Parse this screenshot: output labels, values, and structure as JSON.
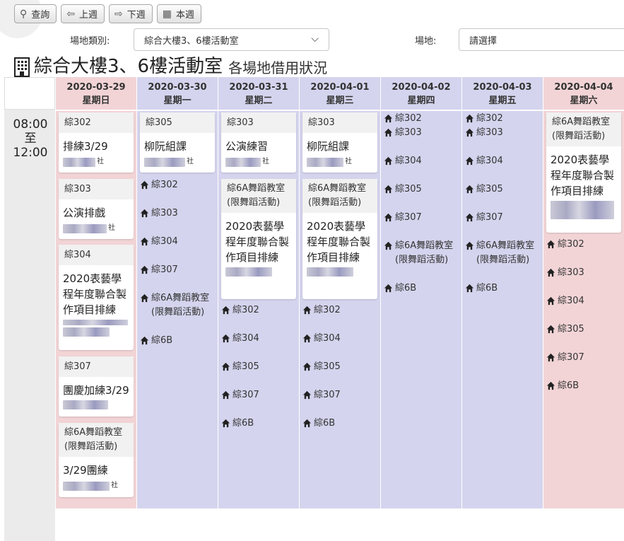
{
  "toolbar": {
    "query": "查詢",
    "prev": "上週",
    "next": "下週",
    "this_week": "本週"
  },
  "filters": {
    "category_label": "場地類別:",
    "category_value": "綜合大樓3、6樓活動室",
    "venue_label": "場地:",
    "venue_placeholder": "請選擇"
  },
  "title": {
    "main": "綜合大樓3、6樓活動室",
    "sub": "各場地借用狀況"
  },
  "time_slot": {
    "start": "08:00",
    "to": "至",
    "end": "12:00"
  },
  "days": [
    {
      "date": "2020-03-29",
      "weekday": "星期日"
    },
    {
      "date": "2020-03-30",
      "weekday": "星期一"
    },
    {
      "date": "2020-03-31",
      "weekday": "星期二"
    },
    {
      "date": "2020-04-01",
      "weekday": "星期三"
    },
    {
      "date": "2020-04-02",
      "weekday": "星期四"
    },
    {
      "date": "2020-04-03",
      "weekday": "星期五"
    },
    {
      "date": "2020-04-04",
      "weekday": "星期六"
    }
  ],
  "bookings": {
    "sun": [
      {
        "room": "綜302",
        "event": "排練3/29",
        "org": "社"
      },
      {
        "room": "綜303",
        "event": "公演排戲",
        "org": "社"
      },
      {
        "room": "綜304",
        "event": "2020表藝學程年度聯合製作項目排練",
        "org": ""
      },
      {
        "room": "綜307",
        "event": "團慶加練3/29",
        "org": ""
      },
      {
        "room": "綜6A舞蹈教室(限舞蹈活動)",
        "event": "3/29團練",
        "org": "社"
      }
    ],
    "mon": [
      {
        "room": "綜305",
        "event": "柳阮組課",
        "org": "社"
      }
    ],
    "tue": [
      {
        "room": "綜303",
        "event": "公演練習",
        "org": "社"
      },
      {
        "room": "綜6A舞蹈教室(限舞蹈活動)",
        "event": "2020表藝學程年度聯合製作項目排練",
        "org": ""
      }
    ],
    "wed": [
      {
        "room": "綜303",
        "event": "柳阮組課",
        "org": "社"
      },
      {
        "room": "綜6A舞蹈教室(限舞蹈活動)",
        "event": "2020表藝學程年度聯合製作項目排練",
        "org": ""
      }
    ],
    "sat": [
      {
        "room": "綜6A舞蹈教室(限舞蹈活動)",
        "event": "2020表藝學程年度聯合製作項目排練",
        "org": ""
      }
    ]
  },
  "free_rooms": {
    "mon": [
      "綜302",
      "綜303",
      "綜304",
      "綜307",
      "綜6A舞蹈教室(限舞蹈活動)",
      "綜6B"
    ],
    "tue": [
      "綜302",
      "綜304",
      "綜305",
      "綜307",
      "綜6B"
    ],
    "wed": [
      "綜302",
      "綜304",
      "綜305",
      "綜307",
      "綜6B"
    ],
    "thu": [
      "綜302",
      "綜303",
      "綜304",
      "綜305",
      "綜307",
      "綜6A舞蹈教室(限舞蹈活動)",
      "綜6B"
    ],
    "fri": [
      "綜302",
      "綜303",
      "綜304",
      "綜305",
      "綜307",
      "綜6A舞蹈教室(限舞蹈活動)",
      "綜6B"
    ],
    "sat": [
      "綜302",
      "綜303",
      "綜304",
      "綜305",
      "綜307",
      "綜6B"
    ]
  },
  "colors": {
    "weekday": "#d4d4ee",
    "weekend": "#f2d4d6",
    "time_col": "#ebebeb"
  }
}
